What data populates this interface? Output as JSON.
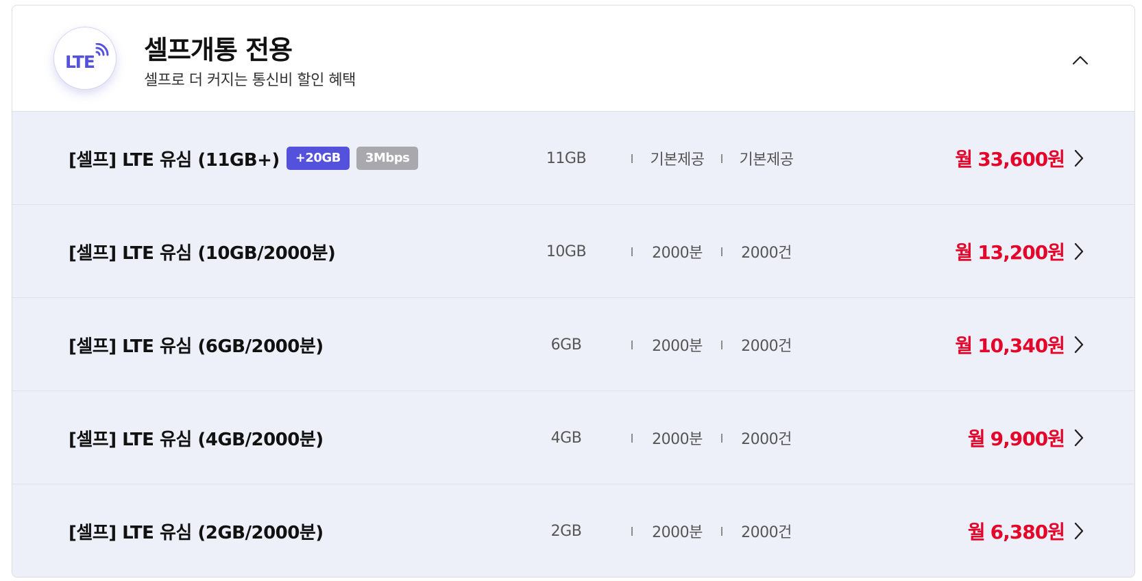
{
  "header": {
    "logo_text": "LTE",
    "title": "셀프개통 전용",
    "subtitle": "셀프로 더 커지는 통신비 할인 혜택",
    "accent_color": "#5452dc"
  },
  "price_color": "#e3062a",
  "plans": [
    {
      "name": "[셀프] LTE 유심 (11GB+)",
      "badges": [
        "+20GB",
        "3Mbps"
      ],
      "data": "11GB",
      "voice": "기본제공",
      "sms": "기본제공",
      "price_prefix": "월",
      "price": "33,600원"
    },
    {
      "name": "[셀프] LTE 유심 (10GB/2000분)",
      "badges": [],
      "data": "10GB",
      "voice": "2000분",
      "sms": "2000건",
      "price_prefix": "월",
      "price": "13,200원"
    },
    {
      "name": "[셀프] LTE 유심 (6GB/2000분)",
      "badges": [],
      "data": "6GB",
      "voice": "2000분",
      "sms": "2000건",
      "price_prefix": "월",
      "price": "10,340원"
    },
    {
      "name": "[셀프] LTE 유심 (4GB/2000분)",
      "badges": [],
      "data": "4GB",
      "voice": "2000분",
      "sms": "2000건",
      "price_prefix": "월",
      "price": "9,900원"
    },
    {
      "name": "[셀프] LTE 유심 (2GB/2000분)",
      "badges": [],
      "data": "2GB",
      "voice": "2000분",
      "sms": "2000건",
      "price_prefix": "월",
      "price": "6,380원"
    }
  ]
}
